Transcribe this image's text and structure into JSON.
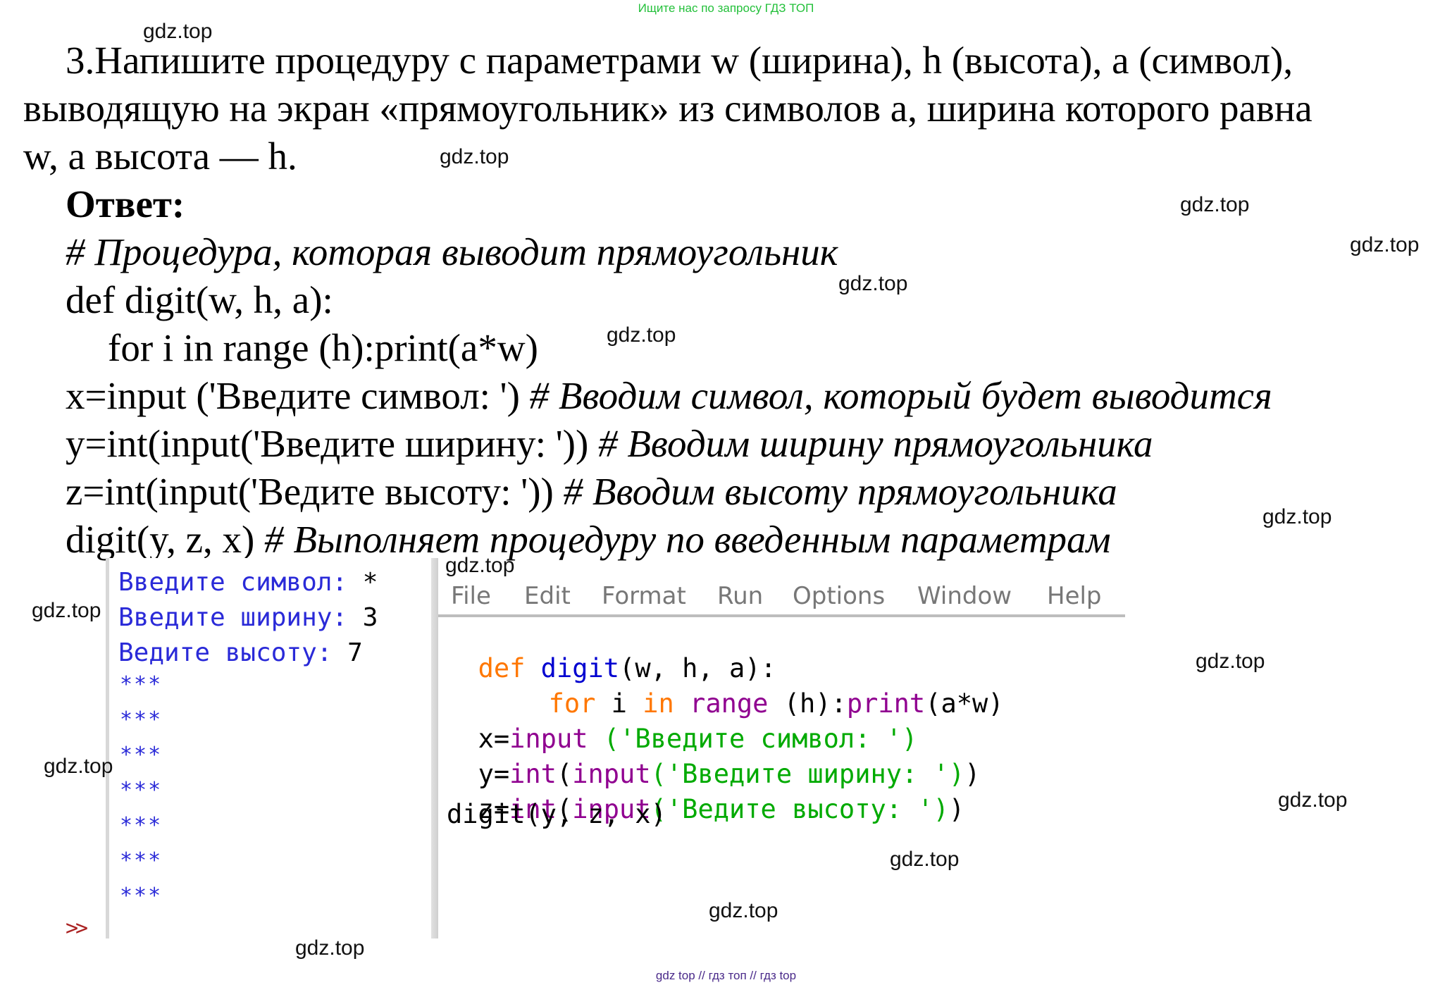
{
  "header_note": "Ищите нас по запросу ГДЗ ТОП",
  "footer_note": "gdz top  //  гдз топ  //  гдз top",
  "watermark": "gdz.top",
  "task": {
    "line1": "3.Напишите процедуру с параметрами w (ширина), h (высота), a (символ),",
    "line2": "выводящую на экран «прямоугольник» из символов a, ширина которого равна",
    "line3": "w, а высота — h."
  },
  "answer_label": "Ответ:",
  "code_text": {
    "comment": "# Процедура, которая выводит прямоугольник",
    "l1": "def digit(w, h, a):",
    "l2": "for i in range (h):print(a*w)",
    "l3_code": "x=input ('Введите символ: ')",
    "l3_comment": "# Вводим символ, который будет выводится",
    "l4_code": "y=int(input('Введите ширину: '))",
    "l4_comment": "# Вводим ширину прямоугольника",
    "l5_code": "z=int(input('Ведите высоту: '))",
    "l5_comment": "# Вводим высоту прямоугольника",
    "l6_code": "digit(y, z, x)",
    "l6_comment": "# Выполняет процедуру по введенным параметрам"
  },
  "shell": {
    "prompt_symbol": "Введите символ: ",
    "value_symbol": "*",
    "prompt_width": "Введите ширину: ",
    "value_width": "3",
    "prompt_height": "Ведите высоту: ",
    "value_height": "7",
    "rows": [
      "***",
      "***",
      "***",
      "***",
      "***",
      "***",
      "***"
    ],
    "prompt": ">>"
  },
  "editor": {
    "menu": [
      "File",
      "Edit",
      "Format",
      "Run",
      "Options",
      "Window",
      "Help"
    ],
    "code": {
      "def": "def",
      "fname": " digit",
      "params": "(w, h, a):",
      "for": "for",
      "i": " i ",
      "in": "in",
      "range": " range",
      "h": " (h):",
      "print": "print",
      "aw": "(a*w)",
      "x": "x=",
      "input1": "input",
      "str1": " ('Введите символ: ')",
      "y": "y=",
      "int1": "int",
      "paren1": "(",
      "input2": "input",
      "str2": "('Введите ширину: ')",
      "close1": ")",
      "z": "z=",
      "int2": "int",
      "paren2": "(",
      "input3": "input",
      "str3": "('Ведите высоту: ')",
      "close2": ")",
      "call": "digit(y, z, x)"
    }
  },
  "colors": {
    "keyword": "#ff7700",
    "function": "#0000d0",
    "builtin": "#900090",
    "string": "#00aa00",
    "shell_output": "#2a2ad8"
  }
}
